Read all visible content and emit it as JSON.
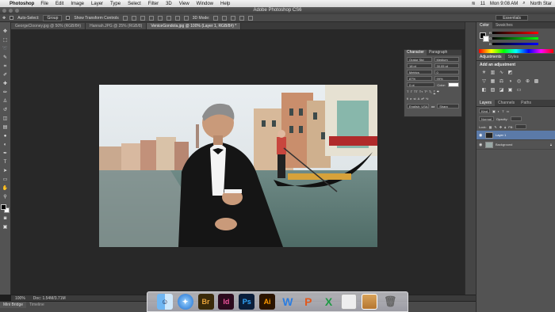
{
  "menubar": {
    "app": "Photoshop",
    "items": [
      "File",
      "Edit",
      "Image",
      "Layer",
      "Type",
      "Select",
      "Filter",
      "3D",
      "View",
      "Window",
      "Help"
    ],
    "right": [
      "11",
      "Mon 9:08 AM",
      "North Star"
    ]
  },
  "titlebar": {
    "title": "Adobe Photoshop CS6"
  },
  "options": {
    "auto_select": "Auto-Select:",
    "auto_select_value": "Group",
    "transform": "Show Transform Controls",
    "mode_3d": "3D Mode:",
    "workspace": "Essentials"
  },
  "tabs": [
    "GeorgeClooney.jpg @ 50% (RGB/8#)",
    "Hannah.JPG @ 25% (RGB/8)",
    "VeniceGondola.jpg @ 100% (Layer 1, RGB/8#) *"
  ],
  "status": {
    "zoom": "100%",
    "doc": "Doc: 1.54M/3.71M"
  },
  "minibridge": {
    "tab1": "Mini Bridge",
    "tab2": "Timeline"
  },
  "character": {
    "tab1": "Character",
    "tab2": "Paragraph",
    "font": "Oratur Std",
    "style": "Medium",
    "size": "18 pt",
    "leading": "30.05 pt",
    "kerning": "Metrics",
    "tracking": "0",
    "vscale": "87%",
    "hscale": "99%",
    "baseline": "0 pt",
    "color_label": "Color:",
    "language": "English: USA",
    "aa": "Sharp",
    "aa_prefix": "aa"
  },
  "panels": {
    "color_tab": "Color",
    "swatches_tab": "Swatches",
    "r": "R",
    "g": "G",
    "b": "B",
    "adjustments_tab": "Adjustments",
    "styles_tab": "Styles",
    "add_adjustment": "Add an adjustment",
    "layers_tab": "Layers",
    "channels_tab": "Channels",
    "paths_tab": "Paths",
    "kind": "Kind",
    "blend": "Normal",
    "opacity_label": "Opacity:",
    "lock_label": "Lock:",
    "fill_label": "Fill:"
  },
  "layers": [
    {
      "name": "Layer 1",
      "selected": true
    },
    {
      "name": "Background",
      "selected": false
    }
  ],
  "dock": [
    "Finder",
    "Safari",
    "Br",
    "Id",
    "Ps",
    "Ai",
    "W",
    "P",
    "X",
    "Preview",
    "Photos",
    "Trash"
  ],
  "colors": {
    "br": "#3a2a0a",
    "br_text": "#e8a33a",
    "id": "#2c0b1e",
    "id_text": "#f0539d",
    "ps": "#0a1e3a",
    "ps_text": "#31a8ff",
    "ai": "#2b1400",
    "ai_text": "#ff9a00"
  }
}
